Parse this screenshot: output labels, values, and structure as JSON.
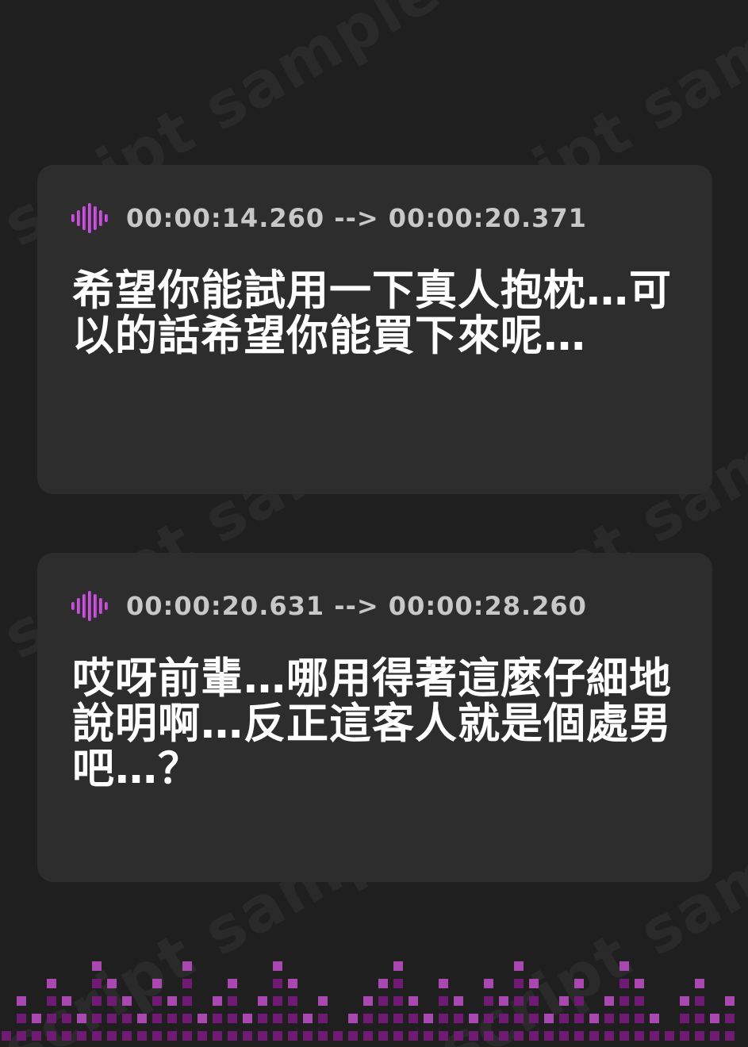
{
  "watermark": "script sample",
  "accent_color": "#c23fd6",
  "cards": [
    {
      "icon": "audio-wave-icon",
      "timestamp": "00:00:14.260 --> 00:00:20.371",
      "text": "希望你能試用一下真人抱枕…可以的話希望你能買下來呢…"
    },
    {
      "icon": "audio-wave-icon",
      "timestamp": "00:00:20.631 --> 00:00:28.260",
      "text": "哎呀前輩…哪用得著這麼仔細地說明啊…反正這客人就是個處男吧…？"
    }
  ],
  "footer": {
    "icon": "equalizer-decoration",
    "bar_levels": [
      1,
      3,
      2,
      4,
      3,
      2,
      5,
      4,
      3,
      2,
      4,
      3,
      5,
      2,
      3,
      4,
      2,
      3,
      5,
      4,
      2,
      3,
      1,
      2,
      3,
      4,
      5,
      3,
      2,
      4,
      3,
      2,
      4,
      3,
      5,
      4,
      2,
      3,
      4,
      2,
      3,
      5,
      4,
      2,
      1,
      3,
      4,
      2,
      3,
      2
    ],
    "color_low": "#6f1a73",
    "color_high": "#a848b0"
  }
}
